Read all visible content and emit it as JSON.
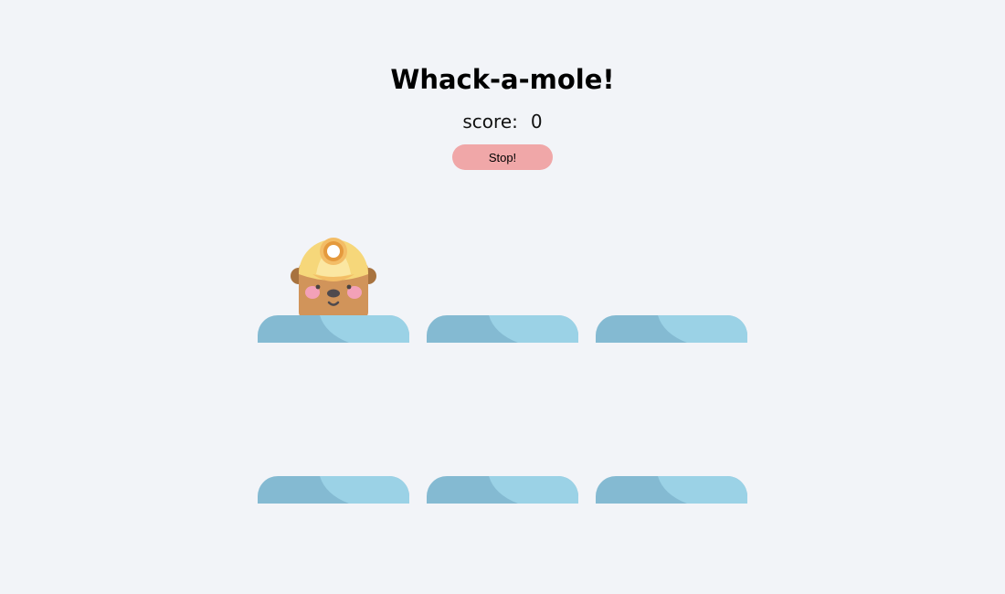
{
  "game": {
    "title": "Whack-a-mole!",
    "score_label": "score:",
    "score_value": "0",
    "stop_label": "Stop!"
  },
  "board": {
    "holes": [
      {
        "row": 1,
        "col": 1,
        "mole_visible": true
      },
      {
        "row": 1,
        "col": 2,
        "mole_visible": false
      },
      {
        "row": 1,
        "col": 3,
        "mole_visible": false
      },
      {
        "row": 2,
        "col": 1,
        "mole_visible": false
      },
      {
        "row": 2,
        "col": 2,
        "mole_visible": false
      },
      {
        "row": 2,
        "col": 3,
        "mole_visible": false
      }
    ],
    "mole_icon": "miner-mole-icon"
  },
  "colors": {
    "background": "#f2f4f8",
    "stop_button": "#f0a7a8",
    "hole_dark": "#84bad2",
    "hole_light": "#9bd2e6",
    "mole_body": "#d1945a",
    "helmet": "#f6d77a"
  }
}
